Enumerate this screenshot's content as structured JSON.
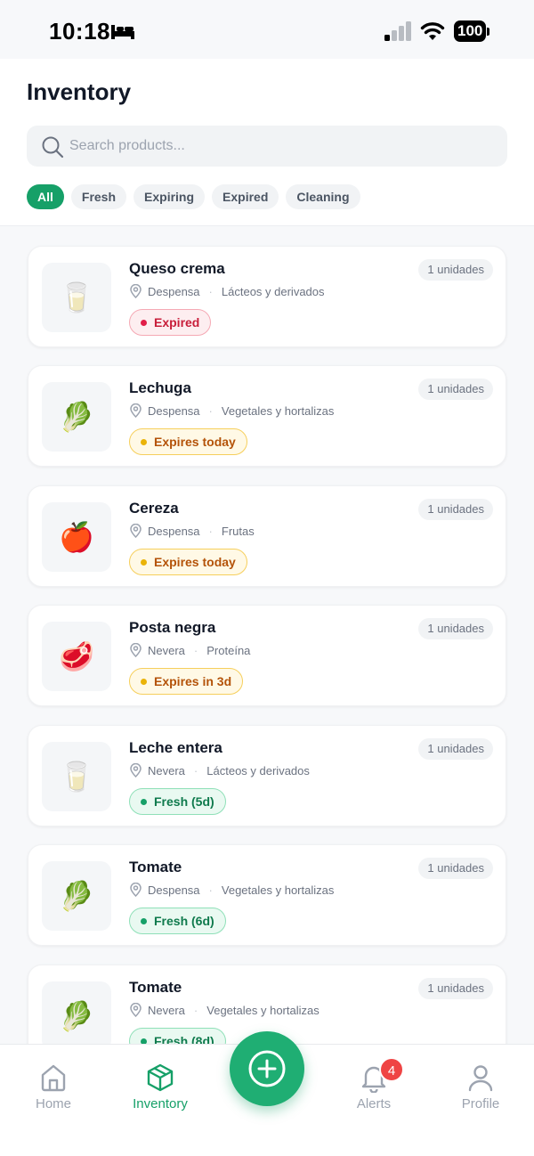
{
  "status_bar": {
    "time": "10:18",
    "battery": "100"
  },
  "header": {
    "title": "Inventory",
    "search_placeholder": "Search products...",
    "filters": [
      "All",
      "Fresh",
      "Expiring",
      "Expired",
      "Cleaning"
    ],
    "active_filter": "All"
  },
  "products": [
    {
      "name": "Queso crema",
      "quantity": "1 unidades",
      "location": "Despensa",
      "category": "Lácteos y derivados",
      "status": "Expired",
      "status_type": "expired",
      "icon": "milk-glass"
    },
    {
      "name": "Lechuga",
      "quantity": "1 unidades",
      "location": "Despensa",
      "category": "Vegetales y hortalizas",
      "status": "Expires today",
      "status_type": "today",
      "icon": "leafy-green"
    },
    {
      "name": "Cereza",
      "quantity": "1 unidades",
      "location": "Despensa",
      "category": "Frutas",
      "status": "Expires today",
      "status_type": "today",
      "icon": "red-apple"
    },
    {
      "name": "Posta negra",
      "quantity": "1 unidades",
      "location": "Nevera",
      "category": "Proteína",
      "status": "Expires in 3d",
      "status_type": "today",
      "icon": "meat-cut"
    },
    {
      "name": "Leche entera",
      "quantity": "1 unidades",
      "location": "Nevera",
      "category": "Lácteos y derivados",
      "status": "Fresh (5d)",
      "status_type": "fresh",
      "icon": "milk-glass"
    },
    {
      "name": "Tomate",
      "quantity": "1 unidades",
      "location": "Despensa",
      "category": "Vegetales y hortalizas",
      "status": "Fresh (6d)",
      "status_type": "fresh",
      "icon": "leafy-green"
    },
    {
      "name": "Tomate",
      "quantity": "1 unidades",
      "location": "Nevera",
      "category": "Vegetales y hortalizas",
      "status": "Fresh (8d)",
      "status_type": "fresh",
      "icon": "leafy-green"
    }
  ],
  "tab_bar": {
    "tabs": [
      {
        "label": "Home",
        "icon": "home-icon"
      },
      {
        "label": "Inventory",
        "icon": "box-icon",
        "active": true
      },
      {
        "label": "Alerts",
        "icon": "bell-icon",
        "badge": "4"
      },
      {
        "label": "Profile",
        "icon": "user-icon"
      }
    ],
    "fab": "add-icon"
  },
  "colors": {
    "accent": "#16a068",
    "expired": "#e11d48",
    "warning": "#eab308",
    "alert_badge": "#ef4444"
  }
}
